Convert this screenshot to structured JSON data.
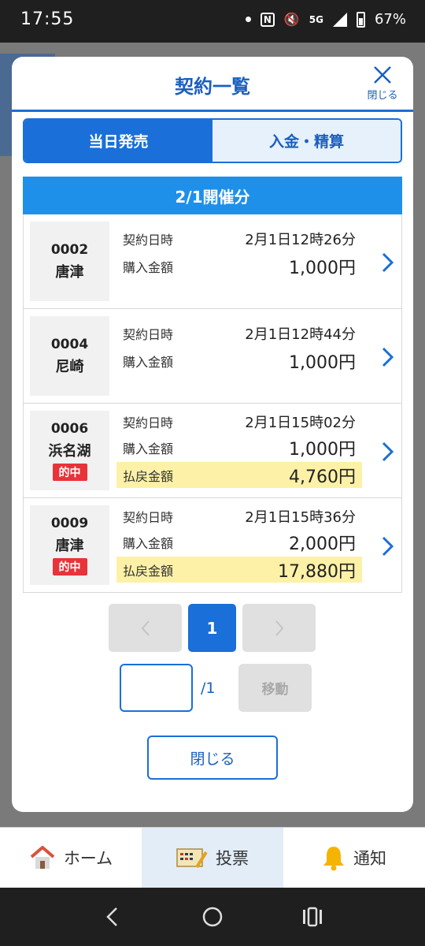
{
  "status_bar": {
    "time": "17:55",
    "network": "5G",
    "battery": "67%"
  },
  "modal": {
    "title": "契約一覧",
    "close_label": "閉じる",
    "tabs": [
      {
        "label": "当日発売",
        "active": true
      },
      {
        "label": "入金・精算",
        "active": false
      }
    ],
    "date_banner": "2/1開催分",
    "labels": {
      "contract_datetime": "契約日時",
      "purchase_amount": "購入金額",
      "payout_amount": "払戻金額",
      "hit": "的中"
    },
    "rows": [
      {
        "number": "0002",
        "venue": "唐津",
        "datetime": "2月1日12時26分",
        "purchase": "1,000円"
      },
      {
        "number": "0004",
        "venue": "尼崎",
        "datetime": "2月1日12時44分",
        "purchase": "1,000円"
      },
      {
        "number": "0006",
        "venue": "浜名湖",
        "hit": true,
        "datetime": "2月1日15時02分",
        "purchase": "1,000円",
        "payout": "4,760円"
      },
      {
        "number": "0009",
        "venue": "唐津",
        "hit": true,
        "datetime": "2月1日15時36分",
        "purchase": "2,000円",
        "payout": "17,880円"
      }
    ],
    "pagination": {
      "current_page": "1",
      "total_pages": "/1",
      "move_label": "移動",
      "input_value": ""
    },
    "footer_close_label": "閉じる"
  },
  "bottom_nav": [
    {
      "label": "ホーム",
      "icon": "house-icon"
    },
    {
      "label": "投票",
      "icon": "ticket-icon",
      "active": true
    },
    {
      "label": "通知",
      "icon": "bell-icon"
    }
  ],
  "colors": {
    "primary": "#1a6fd8",
    "banner": "#1e90ea",
    "hit_badge": "#e8333a",
    "payout_highlight": "#fdf1a7"
  }
}
